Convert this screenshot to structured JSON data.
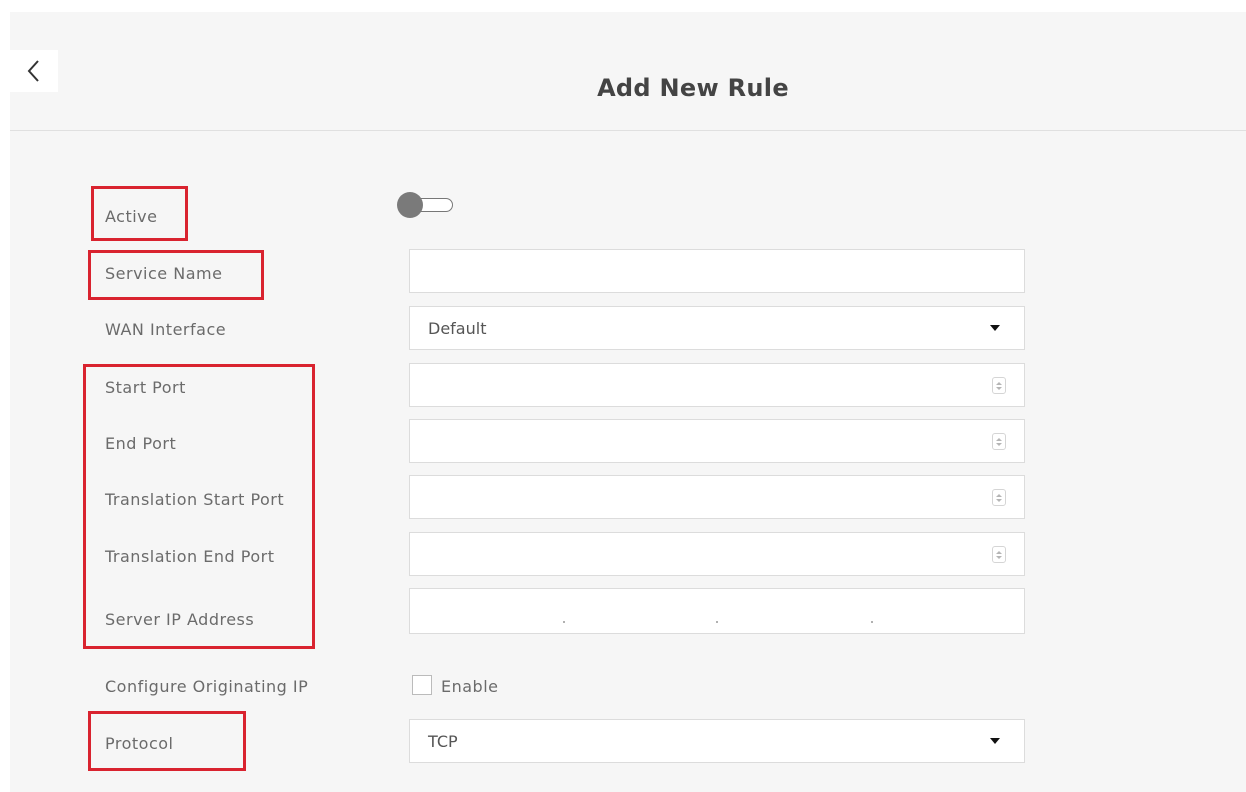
{
  "header": {
    "title": "Add New Rule",
    "back_icon": "chevron-left-icon"
  },
  "form": {
    "active": {
      "label": "Active",
      "toggle_state": "off"
    },
    "service_name": {
      "label": "Service Name",
      "value": ""
    },
    "wan_interface": {
      "label": "WAN Interface",
      "selected": "Default"
    },
    "start_port": {
      "label": "Start Port",
      "value": ""
    },
    "end_port": {
      "label": "End Port",
      "value": ""
    },
    "translation_start_port": {
      "label": "Translation Start Port",
      "value": ""
    },
    "translation_end_port": {
      "label": "Translation End Port",
      "value": ""
    },
    "server_ip": {
      "label": "Server IP Address",
      "separator": "."
    },
    "originating_ip": {
      "label": "Configure Originating IP",
      "checkbox_label": "Enable",
      "checked": false
    },
    "protocol": {
      "label": "Protocol",
      "selected": "TCP"
    }
  },
  "colors": {
    "highlight": "#d9232f",
    "panel_bg": "#f6f6f6",
    "toggle_off": "#7a7a7a"
  }
}
